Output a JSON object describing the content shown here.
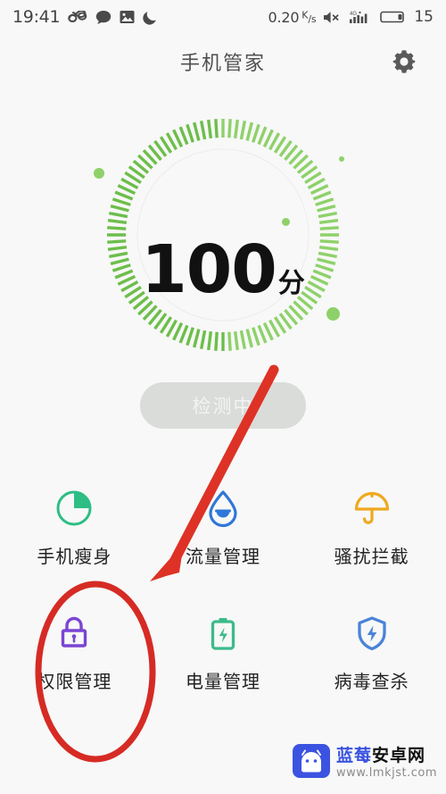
{
  "status_bar": {
    "time": "19:41",
    "left_icons": [
      "infinity-icon",
      "chat-bubble-icon",
      "photo-icon",
      "moon-icon"
    ],
    "network_speed": "0.20",
    "network_speed_unit_top": "K",
    "network_speed_unit_bottom": "s",
    "mute_icon": "speaker-mute-icon",
    "signal_label": "4G",
    "signal_icon": "signal-bars-icon",
    "battery_icon": "battery-icon",
    "battery_level": "15"
  },
  "header": {
    "title": "手机管家",
    "settings_icon": "gear-icon"
  },
  "gauge": {
    "score": "100",
    "unit": "分",
    "ticks_total": 100,
    "ticks_filled": 100,
    "accent_color": "#6dbe4b",
    "accent_light": "#8ed16a",
    "ring_bg_color": "#ebebeb"
  },
  "scan_button": {
    "label": "检测中",
    "bg_color": "#dadcda",
    "text_color": "#f2f3f2"
  },
  "features": [
    {
      "label": "手机瘦身",
      "icon": "pie-chart-icon",
      "color": "#2ebd85"
    },
    {
      "label": "流量管理",
      "icon": "water-drop-icon",
      "color": "#2f77d8"
    },
    {
      "label": "骚扰拦截",
      "icon": "umbrella-icon",
      "color": "#f0a81e"
    },
    {
      "label": "权限管理",
      "icon": "lock-icon",
      "color": "#7b44d4"
    },
    {
      "label": "电量管理",
      "icon": "battery-bolt-icon",
      "color": "#3cba8a"
    },
    {
      "label": "病毒查杀",
      "icon": "shield-bolt-icon",
      "color": "#4a83d8"
    }
  ],
  "annotations": {
    "arrow": {
      "name": "red-arrow-annotation",
      "color": "#de3226",
      "points_to": "流量管理"
    },
    "ellipse": {
      "name": "red-ellipse-annotation",
      "color": "#d62b25",
      "highlights": "权限管理"
    }
  },
  "watermark": {
    "site_name_blue": "蓝莓",
    "site_name_dark": "安卓网",
    "url": "www.lmkjst.com",
    "logo_icon": "android-robot-icon",
    "logo_color": "#3b53e0"
  }
}
